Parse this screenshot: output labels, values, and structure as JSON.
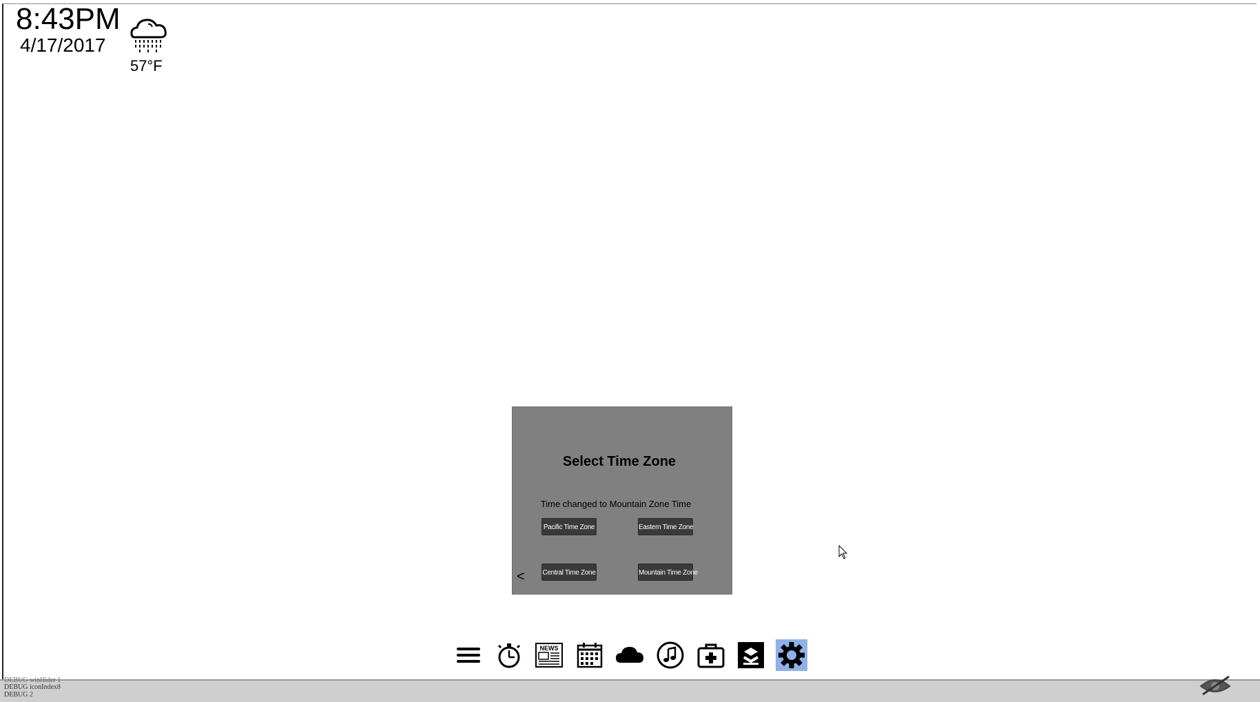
{
  "clock": {
    "time": "8:43PM",
    "date": "4/17/2017"
  },
  "weather": {
    "icon": "rain-cloud-icon",
    "temperature": "57°F"
  },
  "time_zone_dialog": {
    "title": "Select Time Zone",
    "status": "Time changed to Mountain Zone Time",
    "buttons": {
      "pacific": "Pacific Time Zone",
      "eastern": "Eastern Time Zone",
      "central": "Central Time Zone",
      "mountain": "Mountain Time Zone"
    },
    "back": "<",
    "background": "#808080",
    "button_color": "#3a3a3a"
  },
  "dock": {
    "items": [
      {
        "icon": "menu-icon"
      },
      {
        "icon": "stopwatch-icon"
      },
      {
        "icon": "news-icon",
        "label": "NEWS"
      },
      {
        "icon": "calendar-icon"
      },
      {
        "icon": "cloud-icon"
      },
      {
        "icon": "music-icon"
      },
      {
        "icon": "first-aid-icon"
      },
      {
        "icon": "app-logo-icon"
      },
      {
        "icon": "gear-icon",
        "active": true
      }
    ],
    "active_color": "#8fb1e8"
  },
  "debug_bar": {
    "line1": "DEBUG winHider 1",
    "line2": "DEBUG iconIndex8",
    "line3": "DEBUG 2",
    "icon": "hidden-eye-icon"
  }
}
